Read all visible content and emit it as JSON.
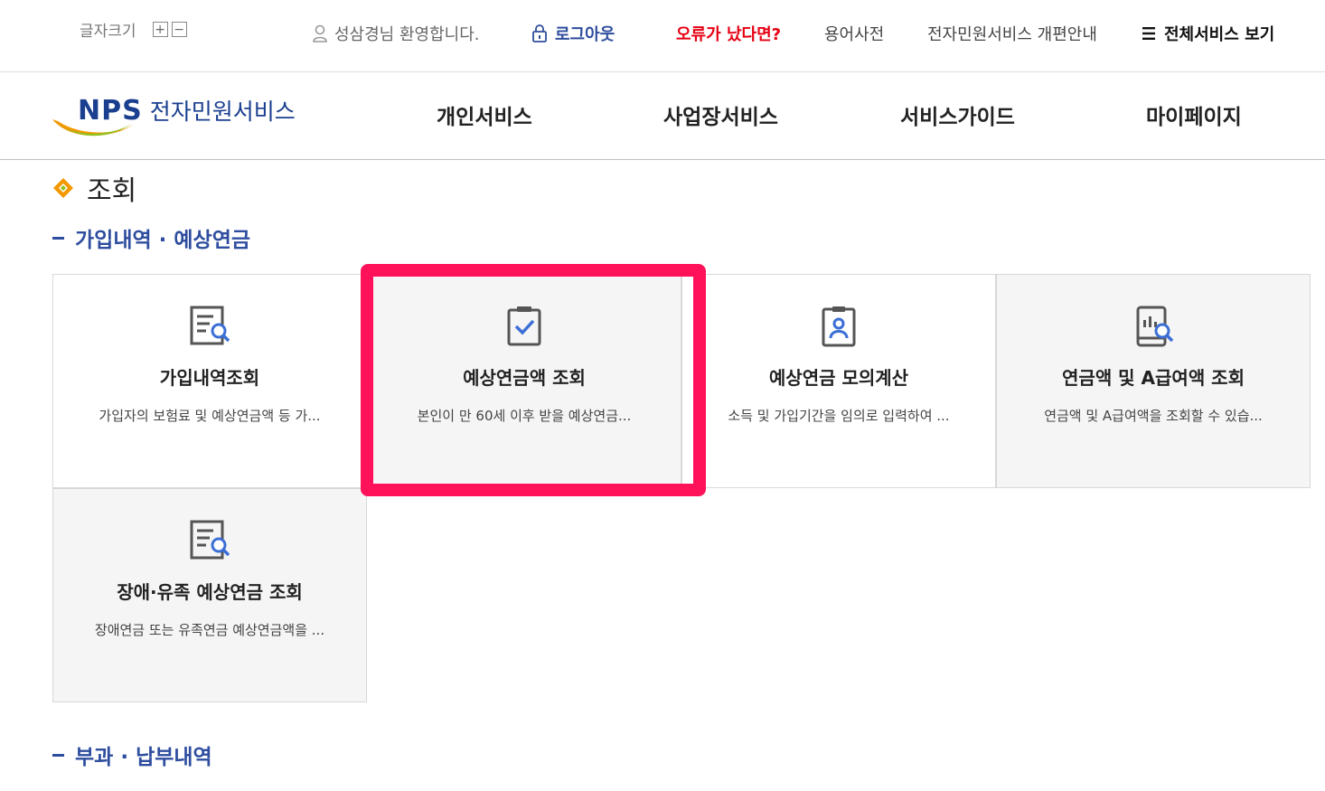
{
  "util": {
    "font_size_label": "글자크기",
    "font_plus": "+",
    "font_minus": "−",
    "welcome": "성삼경님 환영합니다.",
    "logout": "로그아웃",
    "error": "오류가 났다면?",
    "dictionary": "용어사전",
    "renewal_notice": "전자민원서비스 개편안내",
    "all_services": "전체서비스 보기"
  },
  "logo": {
    "brand": "NPS",
    "subtitle": "전자민원서비스"
  },
  "nav": [
    {
      "label": "개인서비스"
    },
    {
      "label": "사업장서비스"
    },
    {
      "label": "서비스가이드"
    },
    {
      "label": "마이페이지"
    }
  ],
  "page_title": "조회",
  "sections": [
    {
      "label": "가입내역 · 예상연금"
    },
    {
      "label": "부과 · 납부내역"
    }
  ],
  "cards": [
    {
      "title": "가입내역조회",
      "desc": "가입자의 보험료 및 예상연금액 등 가...",
      "icon": "document-search-icon"
    },
    {
      "title": "예상연금액 조회",
      "desc": "본인이 만 60세 이후 받을 예상연금...",
      "icon": "clipboard-check-icon"
    },
    {
      "title": "예상연금 모의계산",
      "desc": "소득 및 가입기간을 임의로 입력하여 ...",
      "icon": "id-badge-icon"
    },
    {
      "title": "연금액 및 A급여액 조회",
      "desc": "연금액 및 A급여액을 조회할 수 있습...",
      "icon": "tablet-chart-search-icon"
    },
    {
      "title": "장애·유족 예상연금 조회",
      "desc": "장애연금 또는 유족연금 예상연금액을 ...",
      "icon": "document-search-icon"
    }
  ],
  "colors": {
    "brand_blue": "#2e4d9e",
    "error_red": "#e60012",
    "highlight": "#ff1259",
    "card_gray": "#f5f5f5"
  }
}
